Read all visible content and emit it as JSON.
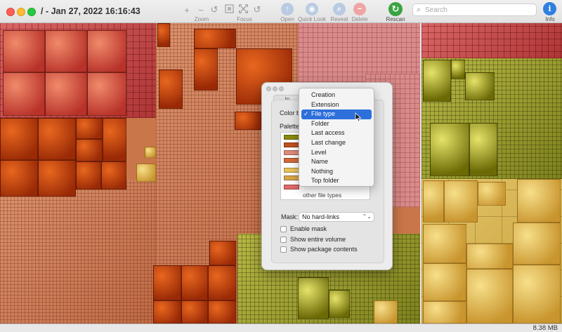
{
  "window": {
    "title": "/ - Jan 27, 2022 16:16:43"
  },
  "toolbar": {
    "zoom_in_icon": "+",
    "zoom_out_icon": "−",
    "undo_icon": "↺",
    "zoom_label": "Zoom",
    "focus_label": "Focus",
    "open_label": "Open",
    "quicklook_label": "Quick Look",
    "reveal_label": "Reveal",
    "delete_label": "Delete",
    "rescan_label": "Rescan",
    "info_label": "Info",
    "info_icon": "i"
  },
  "search": {
    "placeholder": "Search",
    "value": ""
  },
  "status": {
    "size": "8.38 MB"
  },
  "inspector": {
    "tab_label": "In",
    "color_by_label": "Color by",
    "palette_label": "Palette:",
    "other_types_label": "other file types",
    "mask_label": "Mask:",
    "mask_value": "No hard-links",
    "checkboxes": [
      {
        "label": "Enable mask",
        "checked": false
      },
      {
        "label": "Show entire volume",
        "checked": false
      },
      {
        "label": "Show package contents",
        "checked": false
      }
    ],
    "palette_swatches": [
      "#8a8a10",
      "#c0501e",
      "#e08a7a",
      "#d06a3a",
      "#e7c35a",
      "#d8a548",
      "#e06a6a"
    ]
  },
  "color_by_menu": {
    "selected": "File type",
    "items": [
      "Creation",
      "Extension",
      "File type",
      "Folder",
      "Last access",
      "Last change",
      "Level",
      "Name",
      "Nothing",
      "Top folder"
    ]
  },
  "colors": {
    "accent": "#2d6fdb",
    "rescan": "#3aa341",
    "info": "#2f7fe0"
  }
}
